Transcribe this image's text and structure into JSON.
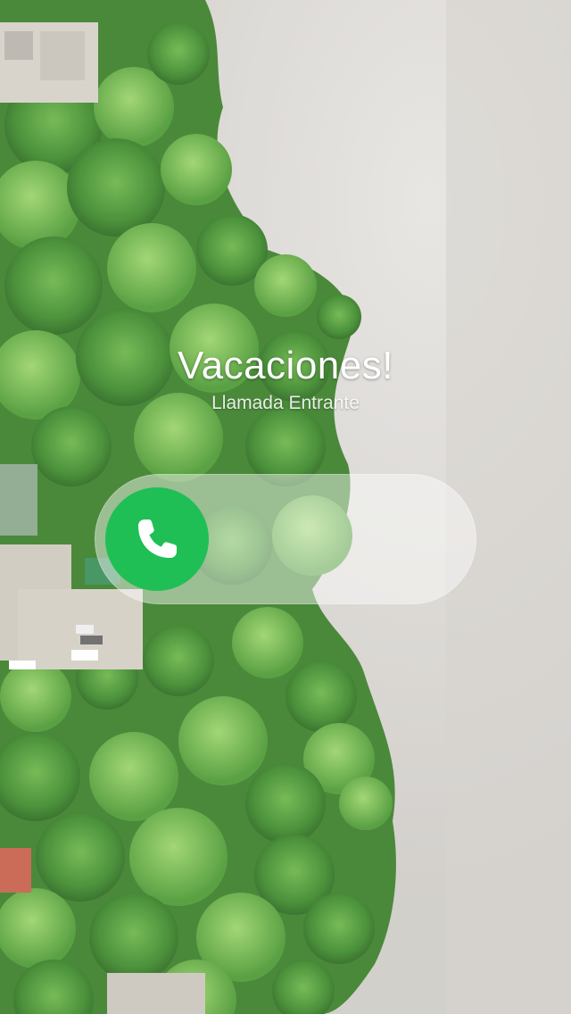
{
  "call": {
    "caller_name": "Vacaciones!",
    "status": "Llamada Entrante"
  },
  "slider": {
    "knob_icon": "phone-icon",
    "knob_color": "#1fbf55",
    "track_color": "rgba(255,255,255,0.45)"
  },
  "wallpaper": {
    "description_icon": "beach-aerial-wallpaper",
    "sand_color": "#d8d6d2",
    "foliage_color": "#3f8f2f"
  }
}
